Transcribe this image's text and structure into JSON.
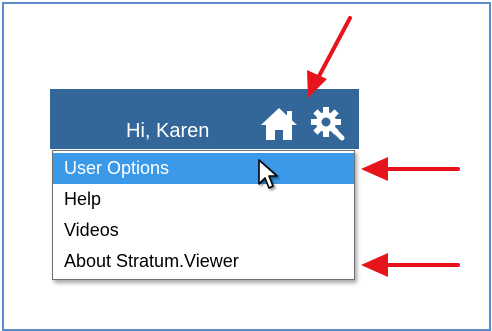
{
  "header": {
    "greeting": "Hi, Karen",
    "background_color": "#336699",
    "home_icon": "home-icon",
    "settings_icon": "gear-icon"
  },
  "menu": {
    "items": [
      {
        "label": "User Options",
        "selected": true
      },
      {
        "label": "Help",
        "selected": false
      },
      {
        "label": "Videos",
        "selected": false
      },
      {
        "label": "About Stratum.Viewer",
        "selected": false
      }
    ],
    "selected_color": "#3a99e8"
  },
  "annotations": {
    "arrow_color": "#e8141b",
    "arrows": [
      "points-to-gear-icon",
      "points-to-user-options",
      "points-to-about-stratum-viewer"
    ]
  },
  "frame_color": "#5b8bc9",
  "pointer_icon": "mouse-pointer-icon"
}
